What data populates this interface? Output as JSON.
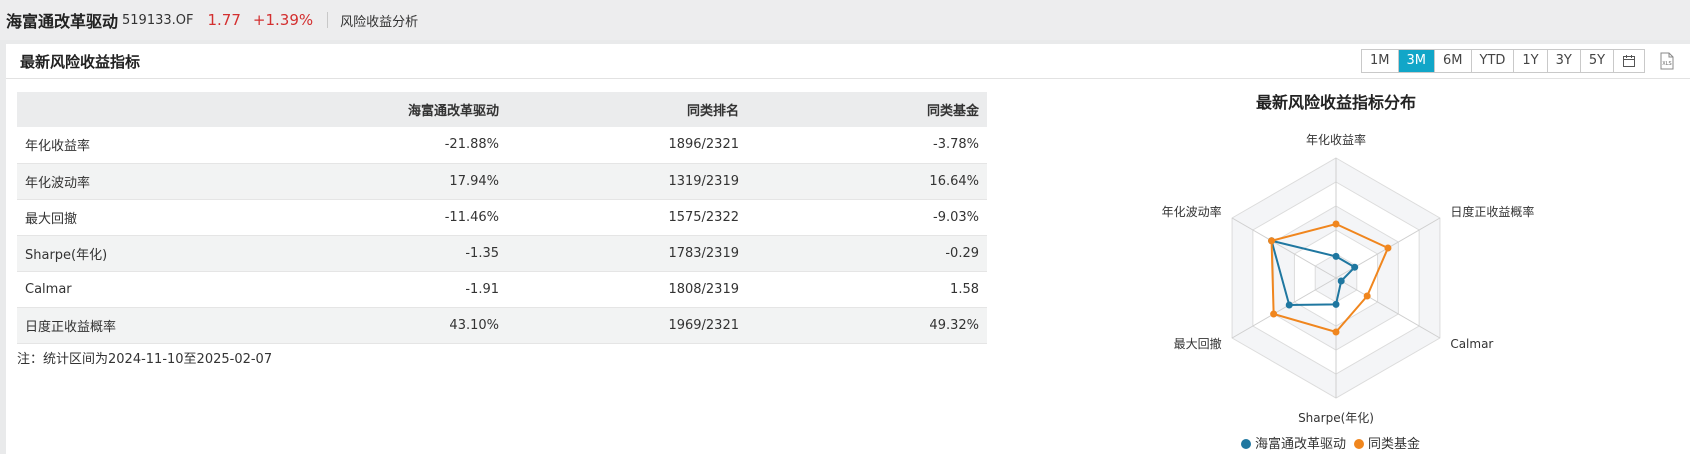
{
  "header": {
    "fund_name": "海富通改革驱动",
    "fund_code": "519133.OF",
    "price": "1.77",
    "change": "+1.39%",
    "page_link": "风险收益分析",
    "colors": {
      "price": "#d32f2f"
    }
  },
  "panel": {
    "title": "最新风险收益指标",
    "periods": [
      {
        "label": "1M",
        "active": false
      },
      {
        "label": "3M",
        "active": true
      },
      {
        "label": "6M",
        "active": false
      },
      {
        "label": "YTD",
        "active": false
      },
      {
        "label": "1Y",
        "active": false
      },
      {
        "label": "3Y",
        "active": false
      },
      {
        "label": "5Y",
        "active": false
      }
    ],
    "calendar_icon": "calendar-icon",
    "export_icon": "xls-export-icon",
    "export_label": "XLS",
    "accent_color": "#11a6c8"
  },
  "table": {
    "headers": [
      "",
      "海富通改革驱动",
      "同类排名",
      "同类基金"
    ],
    "rows": [
      [
        "年化收益率",
        "-21.88%",
        "1896/2321",
        "-3.78%"
      ],
      [
        "年化波动率",
        "17.94%",
        "1319/2319",
        "16.64%"
      ],
      [
        "最大回撤",
        "-11.46%",
        "1575/2322",
        "-9.03%"
      ],
      [
        "Sharpe(年化)",
        "-1.35",
        "1783/2319",
        "-0.29"
      ],
      [
        "Calmar",
        "-1.91",
        "1808/2319",
        "1.58"
      ],
      [
        "日度正收益概率",
        "43.10%",
        "1969/2321",
        "49.32%"
      ]
    ],
    "note": "注：统计区间为2024-11-10至2025-02-07"
  },
  "chart_data": {
    "type": "radar",
    "title": "最新风险收益指标分布",
    "axes": [
      "年化收益率",
      "日度正收益概率",
      "Calmar",
      "Sharpe(年化)",
      "最大回撤",
      "年化波动率"
    ],
    "range": [
      0,
      1
    ],
    "rings": 5,
    "series": [
      {
        "name": "海富通改革驱动",
        "color": "#1f77a0",
        "values": [
          0.18,
          0.18,
          0.05,
          0.22,
          0.45,
          0.62
        ]
      },
      {
        "name": "同类基金",
        "color": "#f0861e",
        "values": [
          0.45,
          0.5,
          0.3,
          0.45,
          0.6,
          0.62
        ]
      }
    ]
  }
}
